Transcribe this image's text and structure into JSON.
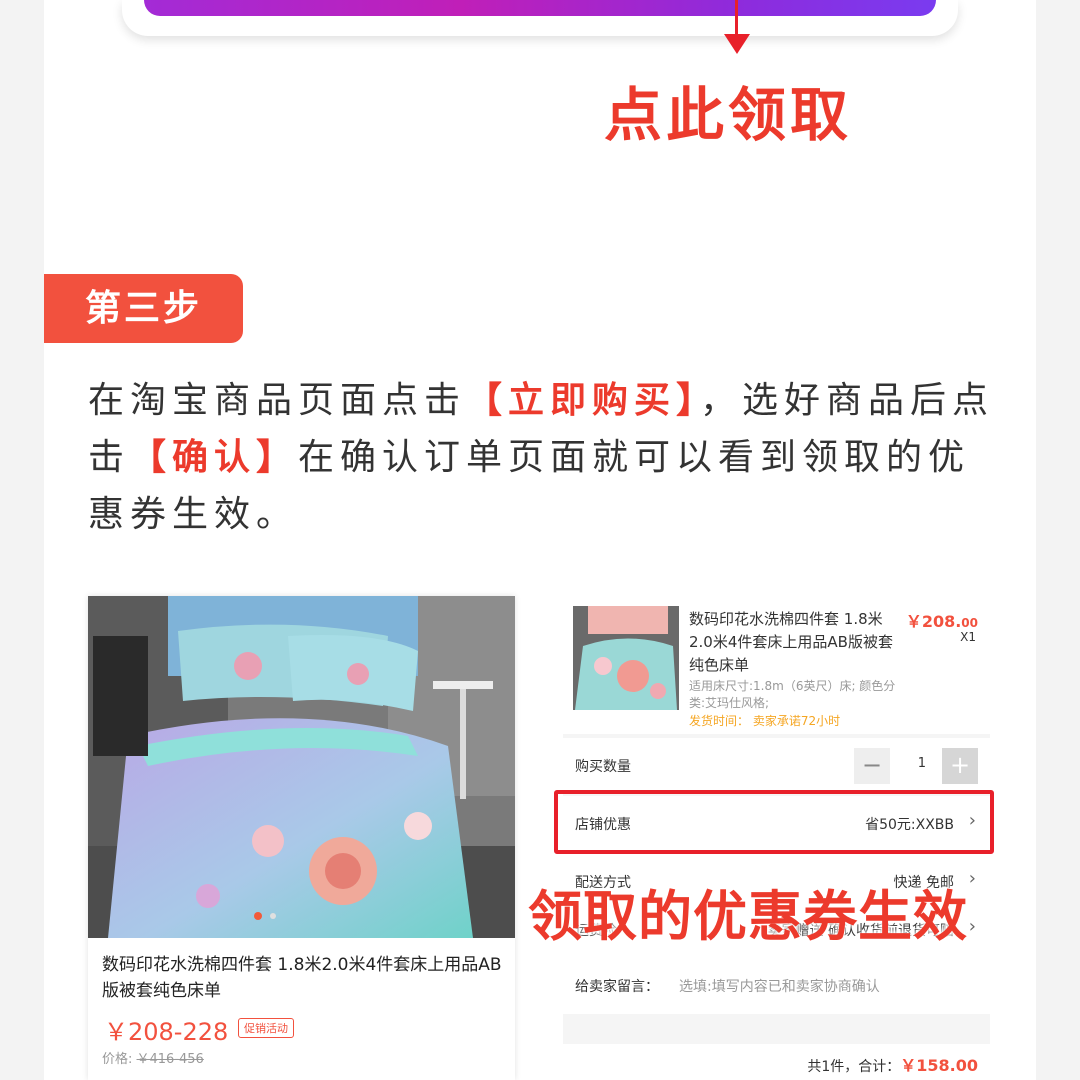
{
  "top": {
    "claim_label": "点此领取"
  },
  "step": {
    "tag": "第三步",
    "instruction_parts": {
      "p1": "在淘宝商品页面点击",
      "h1": "【立即购买】",
      "p2": "，选好商品后点击",
      "h2": "【确认】",
      "p3": "在确认订单页面就可以看到领取的优惠券生效。"
    }
  },
  "product": {
    "title": "数码印花水洗棉四件套 1.8米2.0米4件套床上用品AB版被套纯色床单",
    "price": "￥208-228",
    "promo_badge": "促销活动",
    "orig_price_label": "价格: ",
    "orig_price": "￥416-456"
  },
  "order": {
    "item_title": "数码印花水洗棉四件套 1.8米2.0米4件套床上用品AB版被套纯色床单",
    "item_spec": "适用床尺寸:1.8m（6英尺）床; 颜色分类:艾玛仕风格;",
    "item_ship": "发货时间： 卖家承诺72小时",
    "item_price_main": "￥208.",
    "item_price_cents": "00",
    "item_qty": "X1",
    "qty_label": "购买数量",
    "qty_value": "1",
    "qty_minus": "−",
    "qty_plus": "+",
    "shop_discount_label": "店铺优惠",
    "shop_discount_value": "省50元:XXBB",
    "shipping_label": "配送方式",
    "shipping_value": "快递 免邮",
    "insurance_label": "运费险",
    "insurance_value": "卖家赠送 确认收货前退货可赔",
    "message_label": "给卖家留言：",
    "message_placeholder": "选填:填写内容已和卖家协商确认",
    "total_text": "共1件，合计：",
    "total_amount": "￥158.00",
    "chevron": "›"
  },
  "overlay": {
    "effect_label": "领取的优惠券生效"
  },
  "colors": {
    "accent": "#ec3a2c",
    "step_tag": "#f2513e",
    "price": "#f2513e"
  }
}
